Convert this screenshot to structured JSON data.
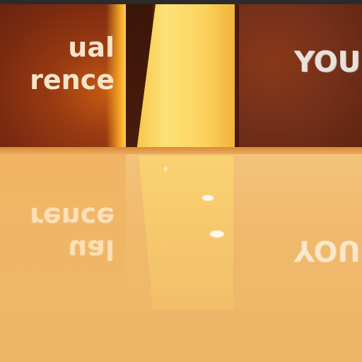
{
  "scene": {
    "left_sign": {
      "lines": [
        "ual",
        "rence"
      ]
    },
    "right_sign": {
      "text": "YOU"
    },
    "floor_reflection": {
      "left_lines": [
        "ual",
        "rence"
      ],
      "right_text": "YOU"
    },
    "colors": {
      "wall": "#6b2810",
      "glow": "#f7c645",
      "floor": "#f0b96c",
      "sign_text": "#f6e4c8"
    }
  }
}
